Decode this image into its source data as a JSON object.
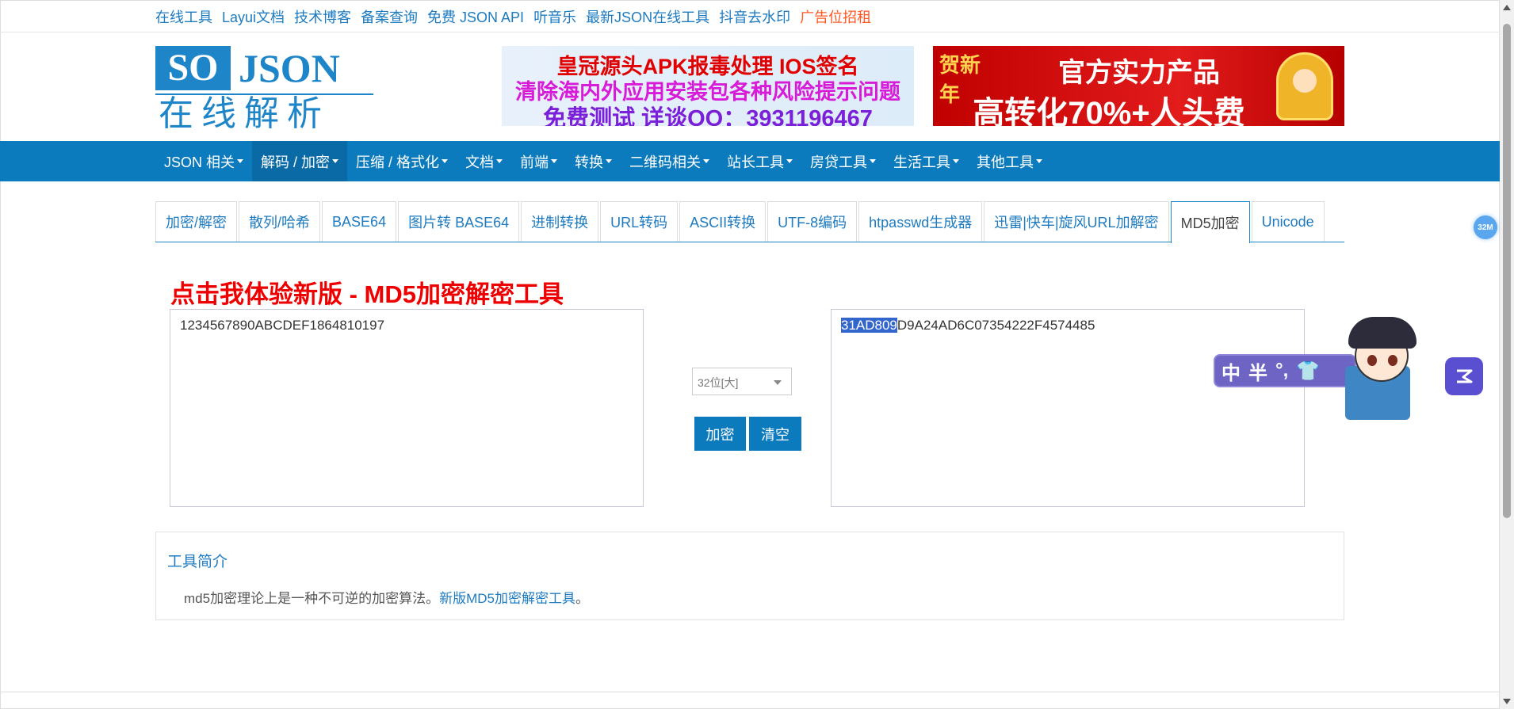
{
  "top_links": [
    {
      "label": "在线工具"
    },
    {
      "label": "Layui文档"
    },
    {
      "label": "技术博客"
    },
    {
      "label": "备案查询"
    },
    {
      "label": "免费 JSON API"
    },
    {
      "label": "听音乐"
    },
    {
      "label": "最新JSON在线工具"
    },
    {
      "label": "抖音去水印"
    },
    {
      "label": "广告位招租"
    }
  ],
  "logo": {
    "so": "SO",
    "json": "JSON",
    "subtitle": "在线解析"
  },
  "ad_left": {
    "line1": "皇冠源头APK报毒处理 IOS签名",
    "line2": "清除海内外应用安装包各种风险提示问题",
    "line3": "免费测试 详谈QQ：3931196467"
  },
  "ad_right": {
    "badge": "贺新年",
    "line1": "官方实力产品",
    "line2": "高转化70%+人头费"
  },
  "nav": [
    {
      "label": "JSON 相关"
    },
    {
      "label": "解码 / 加密"
    },
    {
      "label": "压缩 / 格式化"
    },
    {
      "label": "文档"
    },
    {
      "label": "前端"
    },
    {
      "label": "转换"
    },
    {
      "label": "二维码相关"
    },
    {
      "label": "站长工具"
    },
    {
      "label": "房贷工具"
    },
    {
      "label": "生活工具"
    },
    {
      "label": "其他工具"
    }
  ],
  "nav_active": "解码 / 加密",
  "tabs": [
    {
      "label": "加密/解密"
    },
    {
      "label": "散列/哈希"
    },
    {
      "label": "BASE64"
    },
    {
      "label": "图片转 BASE64"
    },
    {
      "label": "进制转换"
    },
    {
      "label": "URL转码"
    },
    {
      "label": "ASCII转换"
    },
    {
      "label": "UTF-8编码"
    },
    {
      "label": "htpasswd生成器"
    },
    {
      "label": "迅雷|快车|旋风URL加解密"
    },
    {
      "label": "MD5加密"
    },
    {
      "label": "Unicode"
    }
  ],
  "active_tab": "MD5加密",
  "headline": "点击我体验新版 - MD5加密解密工具",
  "input_text": "1234567890ABCDEF1864810197",
  "output": {
    "selected": "31AD809",
    "rest": "D9A24AD6C07354222F4574485"
  },
  "mode_select": "32位[大]",
  "buttons": {
    "encrypt": "加密",
    "clear": "清空"
  },
  "intro": {
    "title": "工具简介",
    "desc": "md5加密理论上是一种不可逆的加密算法。",
    "link": "新版MD5加密解密工具",
    "end": "。"
  },
  "widgets": {
    "badge": "32M",
    "ime": [
      "中",
      "半",
      "°,",
      "👕"
    ]
  },
  "colors": {
    "primary": "#0b7bbd",
    "link": "#1e7bc0",
    "headline": "#ee0000",
    "ad_link": "#ff5722"
  }
}
